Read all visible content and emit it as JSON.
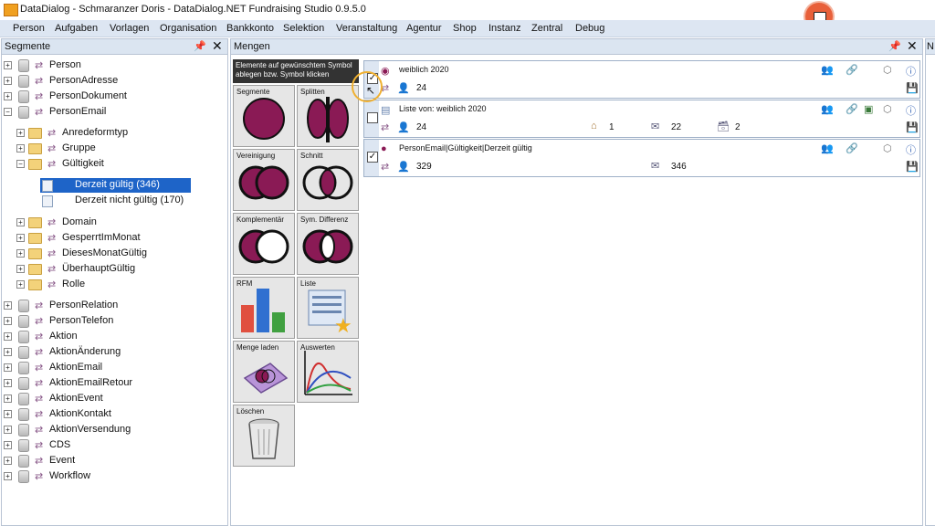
{
  "title": "DataDialog - Schmaranzer Doris - DataDialog.NET Fundraising Studio 0.9.5.0",
  "menu": [
    "Person",
    "Aufgaben",
    "Vorlagen",
    "Organisation",
    "Bankkonto",
    "Selektion",
    "Veranstaltung",
    "Agentur",
    "Shop",
    "Instanz",
    "Zentral",
    "Debug"
  ],
  "left_pane": {
    "title": "Segmente"
  },
  "tree": [
    "Person",
    "PersonAdresse",
    "PersonDokument",
    "PersonEmail",
    "Anredeformtyp",
    "Gruppe",
    "Gültigkeit",
    "Derzeit gültig (346)",
    "Derzeit nicht gültig (170)",
    "Domain",
    "GesperrtImMonat",
    "DiesesMonatGültig",
    "ÜberhauptGültig",
    "Rolle",
    "PersonRelation",
    "PersonTelefon",
    "Aktion",
    "AktionÄnderung",
    "AktionEmail",
    "AktionEmailRetour",
    "AktionEvent",
    "AktionKontakt",
    "AktionVersendung",
    "CDS",
    "Event",
    "Workflow"
  ],
  "mid_pane": {
    "title": "Mengen"
  },
  "tooltip": "Elemente auf gewünschtem Symbol ablegen bzw. Symbol klicken",
  "tools": [
    "Segmente",
    "Splitten",
    "Vereinigung",
    "Schnitt",
    "Komplementär",
    "Sym. Differenz",
    "RFM",
    "Liste",
    "Menge laden",
    "Auswerten",
    "Löschen"
  ],
  "sets": [
    {
      "name": "weiblich 2020",
      "count": "24",
      "checked": true
    },
    {
      "name": "Liste von: weiblich 2020",
      "count": "24",
      "checked": false,
      "houses": "1",
      "mails": "22",
      "boxes": "2"
    },
    {
      "name": "PersonEmail|Gültigkeit|Derzeit gültig",
      "count": "329",
      "checked": true,
      "mails": "346"
    }
  ],
  "right_pane": {
    "title": "N"
  }
}
